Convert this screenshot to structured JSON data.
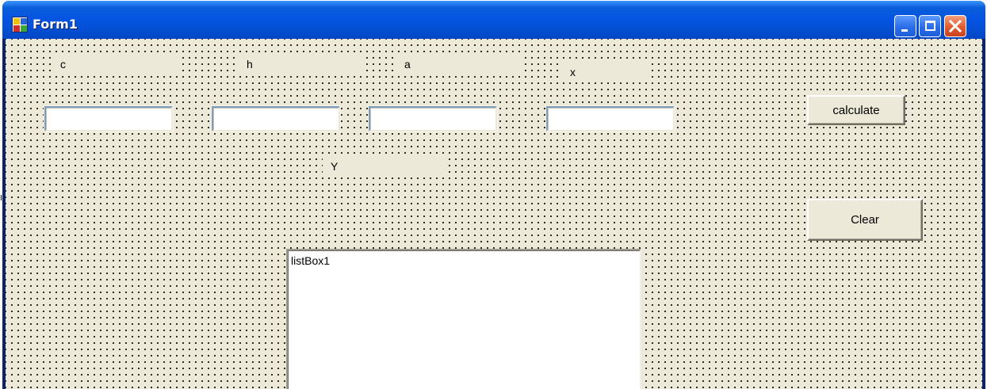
{
  "window": {
    "title": "Form1"
  },
  "form": {
    "labels": {
      "c": "c",
      "h": "h",
      "a": "a",
      "x": "x",
      "y": "Y"
    },
    "inputs": {
      "c_value": "",
      "h_value": "",
      "a_value": "",
      "x_value": ""
    },
    "buttons": {
      "calculate": "calculate",
      "clear": "Clear"
    },
    "listbox": {
      "name": "listBox1"
    }
  },
  "colors": {
    "titlebar": "#0554e3",
    "form_background": "#ece9d8",
    "close_button": "#e25b2d"
  },
  "icons": {
    "app": "form-app-icon",
    "minimize": "minimize-icon",
    "maximize": "maximize-icon",
    "close": "close-icon"
  }
}
